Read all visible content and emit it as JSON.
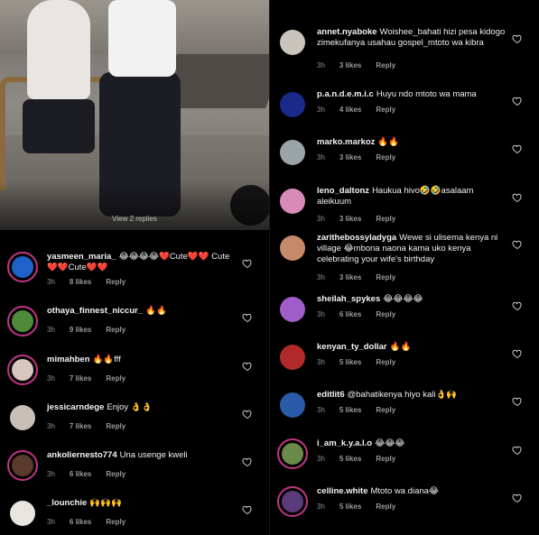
{
  "photo": {
    "watermark": "View 2 replies"
  },
  "left_comments": [
    {
      "username": "yasmeen_maria_",
      "text": "😂😂😂😂❤️Cute❤️❤️ Cute❤️❤️Cute❤️❤️",
      "time": "3h",
      "likes": "8 likes",
      "reply": "Reply",
      "avatar_color": "#1e62c8",
      "ring": true
    },
    {
      "username": "othaya_finnest_niccur_",
      "text": "🔥🔥",
      "time": "3h",
      "likes": "9 likes",
      "reply": "Reply",
      "avatar_color": "#4f8a3a",
      "ring": true
    },
    {
      "username": "mimahben",
      "text": "🔥🔥fff",
      "time": "3h",
      "likes": "7 likes",
      "reply": "Reply",
      "avatar_color": "#d9c6c0",
      "ring": true
    },
    {
      "username": "jessicarndege",
      "text": "Enjoy 👌👌",
      "time": "3h",
      "likes": "7 likes",
      "reply": "Reply",
      "avatar_color": "#c8c0b8",
      "ring": false
    },
    {
      "username": "ankoliernesto774",
      "text": "Una usenge kweli",
      "time": "3h",
      "likes": "6 likes",
      "reply": "Reply",
      "avatar_color": "#5a3a2a",
      "ring": true
    },
    {
      "username": "_lounchie",
      "text": "🙌🙌🙌",
      "time": "3h",
      "likes": "6 likes",
      "reply": "Reply",
      "avatar_color": "#e8e4e0",
      "ring": false
    }
  ],
  "right_comments": [
    {
      "username": "annet.nyaboke",
      "text": "Woishee_bahati hizi pesa kidogo zimekufanya usahau gospel_mtoto wa kibra",
      "time": "3h",
      "likes": "3 likes",
      "reply": "Reply",
      "avatar_color": "#c9c4bc",
      "ring": false
    },
    {
      "username": "p.a.n.d.e.m.i.c",
      "text": "Huyu ndo mtoto wa mama",
      "time": "3h",
      "likes": "4 likes",
      "reply": "Reply",
      "avatar_color": "#1a2a8a",
      "ring": false
    },
    {
      "username": "marko.markoz",
      "text": "🔥🔥",
      "time": "3h",
      "likes": "3 likes",
      "reply": "Reply",
      "avatar_color": "#9aa5a8",
      "ring": false
    },
    {
      "username": "leno_daltonz",
      "text": "Haukua hivo🤣🤣asalaam aleikuum",
      "time": "3h",
      "likes": "3 likes",
      "reply": "Reply",
      "avatar_color": "#d88ab8",
      "ring": false
    },
    {
      "username": "zarithebossyladyga",
      "text": "Wewe si ulisema kenya ni village 😂mbona naona kama uko kenya celebrating your wife's birthday",
      "time": "3h",
      "likes": "3 likes",
      "reply": "Reply",
      "avatar_color": "#c48a6a",
      "ring": false
    },
    {
      "username": "sheilah_spykes",
      "text": "😂😂😂😂",
      "time": "3h",
      "likes": "6 likes",
      "reply": "Reply",
      "avatar_color": "#a05cc8",
      "ring": false
    },
    {
      "username": "kenyan_ty_dollar",
      "text": "🔥🔥",
      "time": "3h",
      "likes": "5 likes",
      "reply": "Reply",
      "avatar_color": "#b02a2a",
      "ring": false
    },
    {
      "username": "editlit6",
      "text": "@bahatikenya hiyo kali👌🙌",
      "time": "3h",
      "likes": "5 likes",
      "reply": "Reply",
      "avatar_color": "#2a5aa8",
      "ring": false
    },
    {
      "username": "i_am_k.y.a.l.o",
      "text": "😂😂😂",
      "time": "3h",
      "likes": "5 likes",
      "reply": "Reply",
      "avatar_color": "#6a8a4a",
      "ring": true
    },
    {
      "username": "celline.white",
      "text": "Mtoto wa diana😂",
      "time": "3h",
      "likes": "5 likes",
      "reply": "Reply",
      "avatar_color": "#5a3a7a",
      "ring": true
    }
  ]
}
